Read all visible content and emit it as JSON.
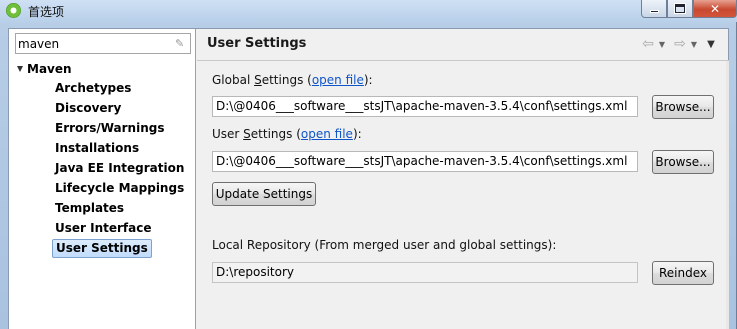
{
  "window": {
    "title": "首选项"
  },
  "filter": {
    "value": "maven"
  },
  "tree": {
    "root": "Maven",
    "items": [
      "Archetypes",
      "Discovery",
      "Errors/Warnings",
      "Installations",
      "Java EE Integration",
      "Lifecycle Mappings",
      "Templates",
      "User Interface",
      "User Settings"
    ],
    "selected": "User Settings"
  },
  "page": {
    "title": "User Settings",
    "global_label_pre": "Global ",
    "global_label_mid": "S",
    "global_label_rest": "ettings (",
    "global_link": "open file",
    "global_label_end": "):",
    "global_value": "D:\\@0406___software___stsJT\\apache-maven-3.5.4\\conf\\settings.xml",
    "user_label_pre": "User ",
    "user_label_mid": "S",
    "user_label_rest": "ettings (",
    "user_link": "open file",
    "user_label_end": "):",
    "user_value": "D:\\@0406___software___stsJT\\apache-maven-3.5.4\\conf\\settings.xml",
    "browse_label": "Browse...",
    "update_label": "Update Settings",
    "local_repo_label": "Local Repository (From merged user and global settings):",
    "local_repo_value": "D:\\repository",
    "reindex_label": "Reindex"
  },
  "icons": {
    "app": "eclipse-icon",
    "clear": "eraser-icon",
    "back": "back-arrow-icon",
    "forward": "forward-arrow-icon",
    "menu": "view-menu-icon"
  }
}
